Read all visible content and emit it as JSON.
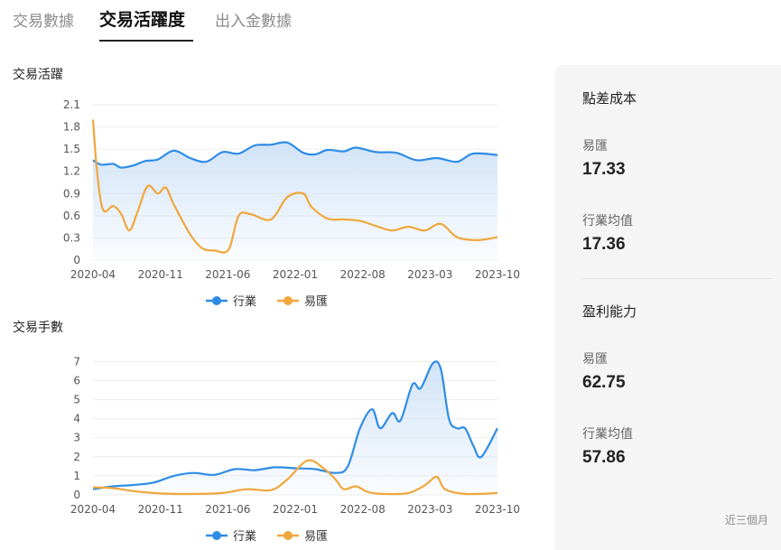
{
  "tabs": [
    {
      "label": "交易數據",
      "active": false
    },
    {
      "label": "交易活躍度",
      "active": true
    },
    {
      "label": "出入金數據",
      "active": false
    }
  ],
  "chart_data": [
    {
      "type": "line",
      "title": "交易活躍",
      "x_tick_labels": [
        "2020-04",
        "2020-11",
        "2021-06",
        "2022-01",
        "2022-08",
        "2023-03",
        "2023-10"
      ],
      "y_ticks": [
        0,
        0.3,
        0.6,
        0.9,
        1.2,
        1.5,
        1.8,
        2.1
      ],
      "y_tick_labels": [
        "0",
        "0.3",
        "0.6",
        "0.9",
        "1.2",
        "1.5",
        "1.8",
        "2.1"
      ],
      "ylim": [
        0,
        2.1
      ],
      "grid": true,
      "legend_position": "bottom-center",
      "series": [
        {
          "name": "行業",
          "color": "#2f8ce6",
          "area": true,
          "points": [
            [
              0,
              1.35
            ],
            [
              0.02,
              1.29
            ],
            [
              0.05,
              1.3
            ],
            [
              0.07,
              1.25
            ],
            [
              0.1,
              1.28
            ],
            [
              0.13,
              1.34
            ],
            [
              0.16,
              1.36
            ],
            [
              0.2,
              1.48
            ],
            [
              0.24,
              1.38
            ],
            [
              0.28,
              1.33
            ],
            [
              0.32,
              1.46
            ],
            [
              0.36,
              1.44
            ],
            [
              0.4,
              1.55
            ],
            [
              0.44,
              1.56
            ],
            [
              0.48,
              1.59
            ],
            [
              0.52,
              1.45
            ],
            [
              0.55,
              1.43
            ],
            [
              0.58,
              1.49
            ],
            [
              0.62,
              1.47
            ],
            [
              0.65,
              1.52
            ],
            [
              0.7,
              1.46
            ],
            [
              0.75,
              1.45
            ],
            [
              0.8,
              1.35
            ],
            [
              0.85,
              1.38
            ],
            [
              0.9,
              1.33
            ],
            [
              0.94,
              1.44
            ],
            [
              1.0,
              1.42
            ]
          ]
        },
        {
          "name": "易匯",
          "color": "#f0a73c",
          "area": false,
          "points": [
            [
              0,
              1.9
            ],
            [
              0.01,
              1.2
            ],
            [
              0.025,
              0.68
            ],
            [
              0.05,
              0.73
            ],
            [
              0.07,
              0.62
            ],
            [
              0.09,
              0.4
            ],
            [
              0.11,
              0.65
            ],
            [
              0.135,
              1.0
            ],
            [
              0.16,
              0.9
            ],
            [
              0.18,
              0.98
            ],
            [
              0.2,
              0.75
            ],
            [
              0.24,
              0.35
            ],
            [
              0.27,
              0.16
            ],
            [
              0.3,
              0.13
            ],
            [
              0.335,
              0.14
            ],
            [
              0.36,
              0.6
            ],
            [
              0.39,
              0.62
            ],
            [
              0.44,
              0.55
            ],
            [
              0.48,
              0.85
            ],
            [
              0.52,
              0.9
            ],
            [
              0.54,
              0.72
            ],
            [
              0.58,
              0.56
            ],
            [
              0.62,
              0.55
            ],
            [
              0.66,
              0.53
            ],
            [
              0.7,
              0.46
            ],
            [
              0.74,
              0.4
            ],
            [
              0.78,
              0.45
            ],
            [
              0.82,
              0.4
            ],
            [
              0.86,
              0.49
            ],
            [
              0.9,
              0.31
            ],
            [
              0.95,
              0.27
            ],
            [
              1.0,
              0.31
            ]
          ]
        }
      ]
    },
    {
      "type": "line",
      "title": "交易手數",
      "x_tick_labels": [
        "2020-04",
        "2020-11",
        "2021-06",
        "2022-01",
        "2022-08",
        "2023-03",
        "2023-10"
      ],
      "y_ticks": [
        0,
        1,
        2,
        3,
        4,
        5,
        6,
        7
      ],
      "y_tick_labels": [
        "0",
        "1",
        "2",
        "3",
        "4",
        "5",
        "6",
        "7"
      ],
      "ylim": [
        0,
        7.3
      ],
      "grid": true,
      "legend_position": "bottom-center",
      "series": [
        {
          "name": "行業",
          "color": "#2f8ce6",
          "area": true,
          "points": [
            [
              0,
              0.3
            ],
            [
              0.05,
              0.45
            ],
            [
              0.1,
              0.52
            ],
            [
              0.15,
              0.65
            ],
            [
              0.2,
              1.0
            ],
            [
              0.25,
              1.15
            ],
            [
              0.3,
              1.05
            ],
            [
              0.35,
              1.35
            ],
            [
              0.4,
              1.3
            ],
            [
              0.45,
              1.45
            ],
            [
              0.5,
              1.4
            ],
            [
              0.55,
              1.35
            ],
            [
              0.6,
              1.15
            ],
            [
              0.63,
              1.5
            ],
            [
              0.66,
              3.5
            ],
            [
              0.69,
              4.5
            ],
            [
              0.71,
              3.5
            ],
            [
              0.74,
              4.3
            ],
            [
              0.76,
              3.9
            ],
            [
              0.79,
              5.8
            ],
            [
              0.81,
              5.6
            ],
            [
              0.84,
              6.9
            ],
            [
              0.86,
              6.6
            ],
            [
              0.88,
              4.0
            ],
            [
              0.9,
              3.5
            ],
            [
              0.92,
              3.5
            ],
            [
              0.94,
              2.6
            ],
            [
              0.96,
              2.0
            ],
            [
              1.0,
              3.5
            ]
          ]
        },
        {
          "name": "易匯",
          "color": "#f0a73c",
          "area": false,
          "points": [
            [
              0,
              0.4
            ],
            [
              0.05,
              0.35
            ],
            [
              0.1,
              0.2
            ],
            [
              0.15,
              0.1
            ],
            [
              0.2,
              0.05
            ],
            [
              0.25,
              0.05
            ],
            [
              0.32,
              0.1
            ],
            [
              0.38,
              0.3
            ],
            [
              0.44,
              0.25
            ],
            [
              0.48,
              0.8
            ],
            [
              0.53,
              1.8
            ],
            [
              0.57,
              1.4
            ],
            [
              0.6,
              0.8
            ],
            [
              0.62,
              0.3
            ],
            [
              0.65,
              0.45
            ],
            [
              0.68,
              0.15
            ],
            [
              0.72,
              0.05
            ],
            [
              0.78,
              0.1
            ],
            [
              0.82,
              0.5
            ],
            [
              0.85,
              0.95
            ],
            [
              0.87,
              0.3
            ],
            [
              0.92,
              0.05
            ],
            [
              1.0,
              0.1
            ]
          ]
        }
      ]
    }
  ],
  "side_panel": {
    "spread_cost": {
      "title": "點差成本",
      "broker_label": "易匯",
      "broker_value": "17.33",
      "industry_label": "行業均值",
      "industry_value": "17.36"
    },
    "profitability": {
      "title": "盈利能力",
      "broker_label": "易匯",
      "broker_value": "62.75",
      "industry_label": "行業均值",
      "industry_value": "57.86"
    },
    "footnote": "近三個月"
  }
}
